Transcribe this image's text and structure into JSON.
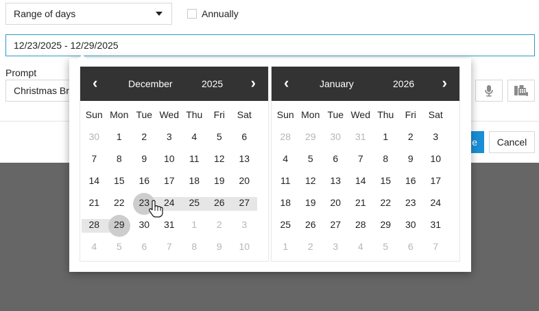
{
  "form": {
    "recurrence_select": "Range of days",
    "annually_label": "Annually",
    "date_range_value": "12/23/2025 - 12/29/2025",
    "prompt_label": "Prompt",
    "prompt_value": "Christmas Br",
    "save_label": "e",
    "cancel_label": "Cancel"
  },
  "picker": {
    "left": {
      "month": "December",
      "year": "2025",
      "prev": "‹",
      "next": "›",
      "dow": [
        "Sun",
        "Mon",
        "Tue",
        "Wed",
        "Thu",
        "Fri",
        "Sat"
      ],
      "weeks": [
        [
          {
            "d": "30",
            "m": true
          },
          {
            "d": "1"
          },
          {
            "d": "2"
          },
          {
            "d": "3"
          },
          {
            "d": "4"
          },
          {
            "d": "5"
          },
          {
            "d": "6"
          }
        ],
        [
          {
            "d": "7"
          },
          {
            "d": "8"
          },
          {
            "d": "9"
          },
          {
            "d": "10"
          },
          {
            "d": "11"
          },
          {
            "d": "12"
          },
          {
            "d": "13"
          }
        ],
        [
          {
            "d": "14"
          },
          {
            "d": "15"
          },
          {
            "d": "16"
          },
          {
            "d": "17"
          },
          {
            "d": "18"
          },
          {
            "d": "19"
          },
          {
            "d": "20"
          }
        ],
        [
          {
            "d": "21"
          },
          {
            "d": "22"
          },
          {
            "d": "23",
            "r": "start"
          },
          {
            "d": "24",
            "r": "in"
          },
          {
            "d": "25",
            "r": "in"
          },
          {
            "d": "26",
            "r": "in"
          },
          {
            "d": "27",
            "r": "in"
          }
        ],
        [
          {
            "d": "28",
            "r": "in"
          },
          {
            "d": "29",
            "r": "end"
          },
          {
            "d": "30"
          },
          {
            "d": "31"
          },
          {
            "d": "1",
            "m": true
          },
          {
            "d": "2",
            "m": true
          },
          {
            "d": "3",
            "m": true
          }
        ],
        [
          {
            "d": "4",
            "m": true
          },
          {
            "d": "5",
            "m": true
          },
          {
            "d": "6",
            "m": true
          },
          {
            "d": "7",
            "m": true
          },
          {
            "d": "8",
            "m": true
          },
          {
            "d": "9",
            "m": true
          },
          {
            "d": "10",
            "m": true
          }
        ]
      ]
    },
    "right": {
      "month": "January",
      "year": "2026",
      "prev": "‹",
      "next": "›",
      "dow": [
        "Sun",
        "Mon",
        "Tue",
        "Wed",
        "Thu",
        "Fri",
        "Sat"
      ],
      "weeks": [
        [
          {
            "d": "28",
            "m": true
          },
          {
            "d": "29",
            "m": true
          },
          {
            "d": "30",
            "m": true
          },
          {
            "d": "31",
            "m": true
          },
          {
            "d": "1"
          },
          {
            "d": "2"
          },
          {
            "d": "3"
          }
        ],
        [
          {
            "d": "4"
          },
          {
            "d": "5"
          },
          {
            "d": "6"
          },
          {
            "d": "7"
          },
          {
            "d": "8"
          },
          {
            "d": "9"
          },
          {
            "d": "10"
          }
        ],
        [
          {
            "d": "11"
          },
          {
            "d": "12"
          },
          {
            "d": "13"
          },
          {
            "d": "14"
          },
          {
            "d": "15"
          },
          {
            "d": "16"
          },
          {
            "d": "17"
          }
        ],
        [
          {
            "d": "18"
          },
          {
            "d": "19"
          },
          {
            "d": "20"
          },
          {
            "d": "21"
          },
          {
            "d": "22"
          },
          {
            "d": "23"
          },
          {
            "d": "24"
          }
        ],
        [
          {
            "d": "25"
          },
          {
            "d": "26"
          },
          {
            "d": "27"
          },
          {
            "d": "28"
          },
          {
            "d": "29"
          },
          {
            "d": "30"
          },
          {
            "d": "31"
          }
        ],
        [
          {
            "d": "1",
            "m": true
          },
          {
            "d": "2",
            "m": true
          },
          {
            "d": "3",
            "m": true
          },
          {
            "d": "4",
            "m": true
          },
          {
            "d": "5",
            "m": true
          },
          {
            "d": "6",
            "m": true
          },
          {
            "d": "7",
            "m": true
          }
        ]
      ]
    }
  },
  "icons": {
    "dropdown": "caret-down-icon",
    "microphone": "microphone-icon",
    "phone": "phone-icon",
    "cursor": "hand-cursor-icon"
  },
  "colors": {
    "header": "#333333",
    "range": "#e6e6e6",
    "edge": "#cdcdcd",
    "focus_border": "#2a9ac0",
    "primary": "#1a8ed6",
    "overlay": "#666666"
  }
}
